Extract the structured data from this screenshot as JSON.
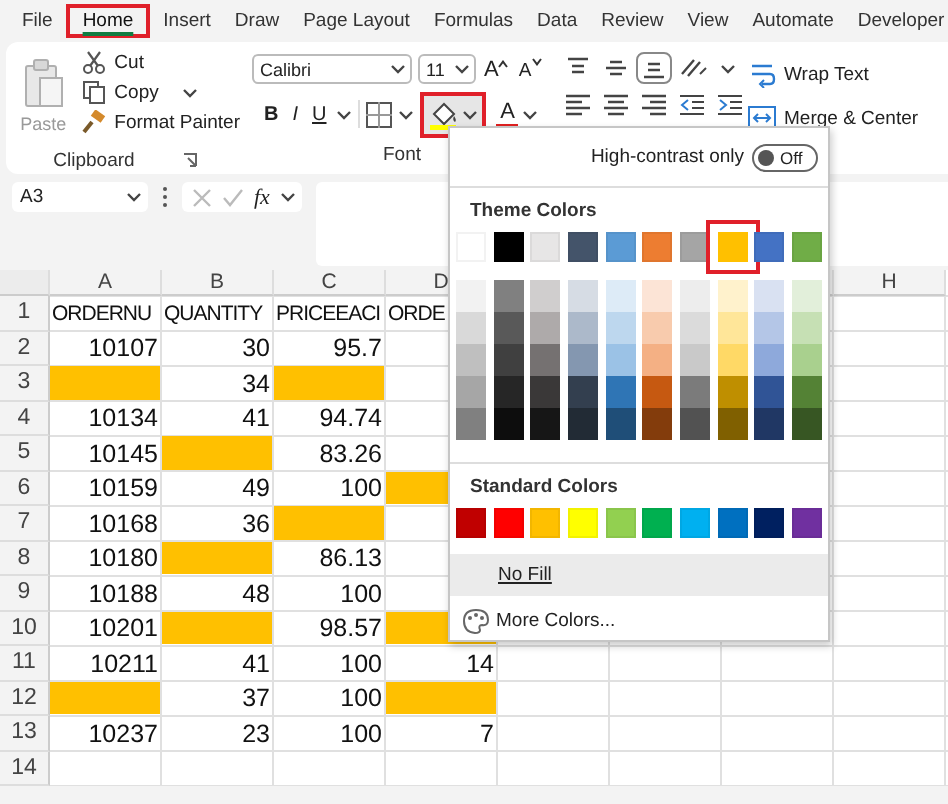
{
  "tabs": [
    {
      "label": "File",
      "selected": false,
      "highlighted": false
    },
    {
      "label": "Home",
      "selected": true,
      "highlighted": true
    },
    {
      "label": "Insert",
      "selected": false,
      "highlighted": false
    },
    {
      "label": "Draw",
      "selected": false,
      "highlighted": false
    },
    {
      "label": "Page Layout",
      "selected": false,
      "highlighted": false
    },
    {
      "label": "Formulas",
      "selected": false,
      "highlighted": false
    },
    {
      "label": "Data",
      "selected": false,
      "highlighted": false
    },
    {
      "label": "Review",
      "selected": false,
      "highlighted": false
    },
    {
      "label": "View",
      "selected": false,
      "highlighted": false
    },
    {
      "label": "Automate",
      "selected": false,
      "highlighted": false
    },
    {
      "label": "Developer",
      "selected": false,
      "highlighted": false
    }
  ],
  "clipboard": {
    "label": "Clipboard",
    "paste": {
      "label": "Paste",
      "disabled": true
    },
    "cut": "Cut",
    "copy": "Copy",
    "format_painter": "Format Painter"
  },
  "font": {
    "label": "Font",
    "font_name": "Calibri",
    "font_size": "11",
    "grow": "A",
    "shrink": "A",
    "bold": "B",
    "italic": "I",
    "underline": "U",
    "fill_color": {
      "highlighted": true,
      "color": "#ffff00"
    },
    "font_color": {
      "label": "A",
      "color": "#e02020"
    }
  },
  "alignment": {
    "wrap_text": "Wrap Text",
    "merge_center": "Merge & Center"
  },
  "formula_bar": {
    "name_box": "A3",
    "fx": "fx"
  },
  "sheet": {
    "columns": [
      "A",
      "B",
      "C",
      "D",
      null,
      null,
      null,
      "H"
    ],
    "rows": [
      {
        "header": "1",
        "cells": [
          {
            "kind": "text",
            "text": "ORDERNU"
          },
          {
            "kind": "text",
            "text": "QUANTITY"
          },
          {
            "kind": "text",
            "text": "PRICEEACI"
          },
          {
            "kind": "text",
            "text": "ORDE"
          }
        ]
      },
      {
        "header": "2",
        "cells": [
          {
            "kind": "number",
            "text": "10107"
          },
          {
            "kind": "number",
            "text": "30"
          },
          {
            "kind": "number",
            "text": "95.7"
          }
        ]
      },
      {
        "header": "3",
        "cells": [
          {
            "fill": true
          },
          {
            "kind": "number",
            "text": "34"
          },
          {
            "fill": true
          }
        ]
      },
      {
        "header": "4",
        "cells": [
          {
            "kind": "number",
            "text": "10134"
          },
          {
            "kind": "number",
            "text": "41"
          },
          {
            "kind": "number",
            "text": "94.74"
          }
        ]
      },
      {
        "header": "5",
        "cells": [
          {
            "kind": "number",
            "text": "10145"
          },
          {
            "fill": true
          },
          {
            "kind": "number",
            "text": "83.26"
          }
        ]
      },
      {
        "header": "6",
        "cells": [
          {
            "kind": "number",
            "text": "10159"
          },
          {
            "kind": "number",
            "text": "49"
          },
          {
            "kind": "number",
            "text": "100"
          },
          {
            "fill": true
          }
        ]
      },
      {
        "header": "7",
        "cells": [
          {
            "kind": "number",
            "text": "10168"
          },
          {
            "kind": "number",
            "text": "36"
          },
          {
            "fill": true
          }
        ]
      },
      {
        "header": "8",
        "cells": [
          {
            "kind": "number",
            "text": "10180"
          },
          {
            "fill": true
          },
          {
            "kind": "number",
            "text": "86.13"
          }
        ]
      },
      {
        "header": "9",
        "cells": [
          {
            "kind": "number",
            "text": "10188"
          },
          {
            "kind": "number",
            "text": "48"
          },
          {
            "kind": "number",
            "text": "100"
          }
        ]
      },
      {
        "header": "10",
        "cells": [
          {
            "kind": "number",
            "text": "10201"
          },
          {
            "fill": true
          },
          {
            "kind": "number",
            "text": "98.57"
          },
          {
            "fill": true
          }
        ]
      },
      {
        "header": "11",
        "cells": [
          {
            "kind": "number",
            "text": "10211"
          },
          {
            "kind": "number",
            "text": "41"
          },
          {
            "kind": "number",
            "text": "100"
          },
          {
            "kind": "number",
            "text": "14"
          }
        ]
      },
      {
        "header": "12",
        "cells": [
          {
            "fill": true
          },
          {
            "kind": "number",
            "text": "37"
          },
          {
            "kind": "number",
            "text": "100"
          },
          {
            "fill": true
          }
        ]
      },
      {
        "header": "13",
        "cells": [
          {
            "kind": "number",
            "text": "10237"
          },
          {
            "kind": "number",
            "text": "23"
          },
          {
            "kind": "number",
            "text": "100"
          },
          {
            "kind": "number",
            "text": "7"
          }
        ]
      },
      {
        "header": "14",
        "cells": []
      }
    ]
  },
  "fill_menu": {
    "high_contrast": {
      "label": "High-contrast only",
      "on": false,
      "state": "Off"
    },
    "theme_title": "Theme Colors",
    "theme_colors": [
      {
        "color": "#ffffff",
        "highlighted": false,
        "shades": [
          {
            "color": "#f2f2f2"
          },
          {
            "color": "#d9d9d9"
          },
          {
            "color": "#bfbfbf"
          },
          {
            "color": "#a6a6a6"
          },
          {
            "color": "#808080"
          }
        ]
      },
      {
        "color": "#000000",
        "highlighted": false,
        "shades": [
          {
            "color": "#808080"
          },
          {
            "color": "#595959"
          },
          {
            "color": "#404040"
          },
          {
            "color": "#262626"
          },
          {
            "color": "#0d0d0d"
          }
        ]
      },
      {
        "color": "#e7e6e6",
        "highlighted": false,
        "shades": [
          {
            "color": "#d0cece"
          },
          {
            "color": "#aeaaaa"
          },
          {
            "color": "#757171"
          },
          {
            "color": "#3a3838"
          },
          {
            "color": "#161616"
          }
        ]
      },
      {
        "color": "#44546a",
        "highlighted": false,
        "shades": [
          {
            "color": "#d6dce4"
          },
          {
            "color": "#acb9ca"
          },
          {
            "color": "#8497b0"
          },
          {
            "color": "#333f4f"
          },
          {
            "color": "#222b35"
          }
        ]
      },
      {
        "color": "#5b9bd5",
        "highlighted": false,
        "shades": [
          {
            "color": "#ddebf7"
          },
          {
            "color": "#bdd7ee"
          },
          {
            "color": "#9bc2e6"
          },
          {
            "color": "#2f75b5"
          },
          {
            "color": "#1f4e78"
          }
        ]
      },
      {
        "color": "#ed7d31",
        "highlighted": false,
        "shades": [
          {
            "color": "#fce4d6"
          },
          {
            "color": "#f8cbad"
          },
          {
            "color": "#f4b084"
          },
          {
            "color": "#c65911"
          },
          {
            "color": "#833c0c"
          }
        ]
      },
      {
        "color": "#a5a5a5",
        "highlighted": false,
        "shades": [
          {
            "color": "#ededed"
          },
          {
            "color": "#dbdbdb"
          },
          {
            "color": "#c9c9c9"
          },
          {
            "color": "#7b7b7b"
          },
          {
            "color": "#525252"
          }
        ]
      },
      {
        "color": "#ffc000",
        "highlighted": true,
        "shades": [
          {
            "color": "#fff2cc"
          },
          {
            "color": "#ffe699"
          },
          {
            "color": "#ffd966"
          },
          {
            "color": "#bf8f00"
          },
          {
            "color": "#806000"
          }
        ]
      },
      {
        "color": "#4472c4",
        "highlighted": false,
        "shades": [
          {
            "color": "#d9e1f2"
          },
          {
            "color": "#b4c6e7"
          },
          {
            "color": "#8ea9db"
          },
          {
            "color": "#305496"
          },
          {
            "color": "#203764"
          }
        ]
      },
      {
        "color": "#70ad47",
        "highlighted": false,
        "shades": [
          {
            "color": "#e2efda"
          },
          {
            "color": "#c6e0b4"
          },
          {
            "color": "#a9d08e"
          },
          {
            "color": "#548235"
          },
          {
            "color": "#375623"
          }
        ]
      }
    ],
    "standard_title": "Standard Colors",
    "standard_colors": [
      {
        "color": "#c00000"
      },
      {
        "color": "#ff0000"
      },
      {
        "color": "#ffc000"
      },
      {
        "color": "#ffff00"
      },
      {
        "color": "#92d050"
      },
      {
        "color": "#00b050"
      },
      {
        "color": "#00b0f0"
      },
      {
        "color": "#0070c0"
      },
      {
        "color": "#002060"
      },
      {
        "color": "#7030a0"
      }
    ],
    "no_fill": "No Fill",
    "more_colors": "More Colors..."
  }
}
